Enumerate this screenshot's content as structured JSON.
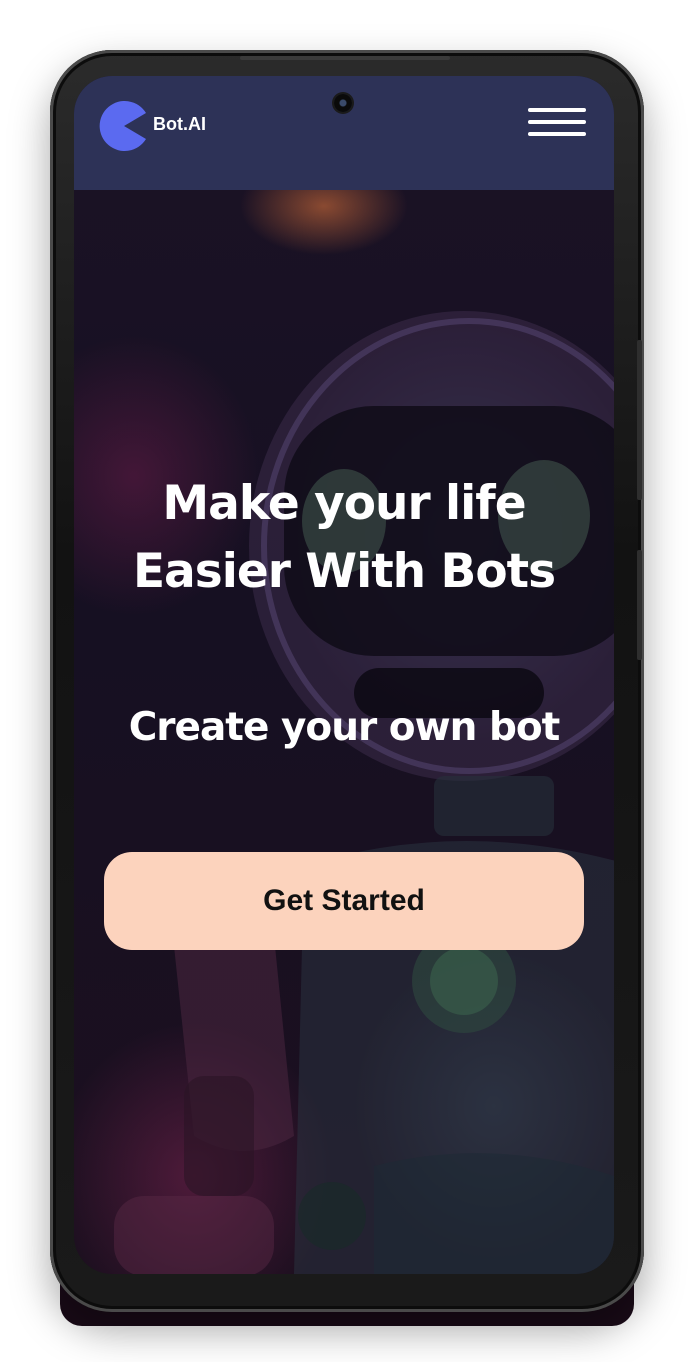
{
  "brand": {
    "name": "Bot.AI",
    "logo_icon": "pacman-logo-icon",
    "logo_color": "#5b6af0"
  },
  "navbar": {
    "menu_icon": "hamburger-menu-icon",
    "background": "#2d3257"
  },
  "hero": {
    "headline_line1": "Make your life",
    "headline_line2": "Easier With Bots",
    "subheadline": "Create your own bot",
    "cta_label": "Get Started",
    "cta_color": "#fcd3bd",
    "background_image": "robot-illustration"
  }
}
